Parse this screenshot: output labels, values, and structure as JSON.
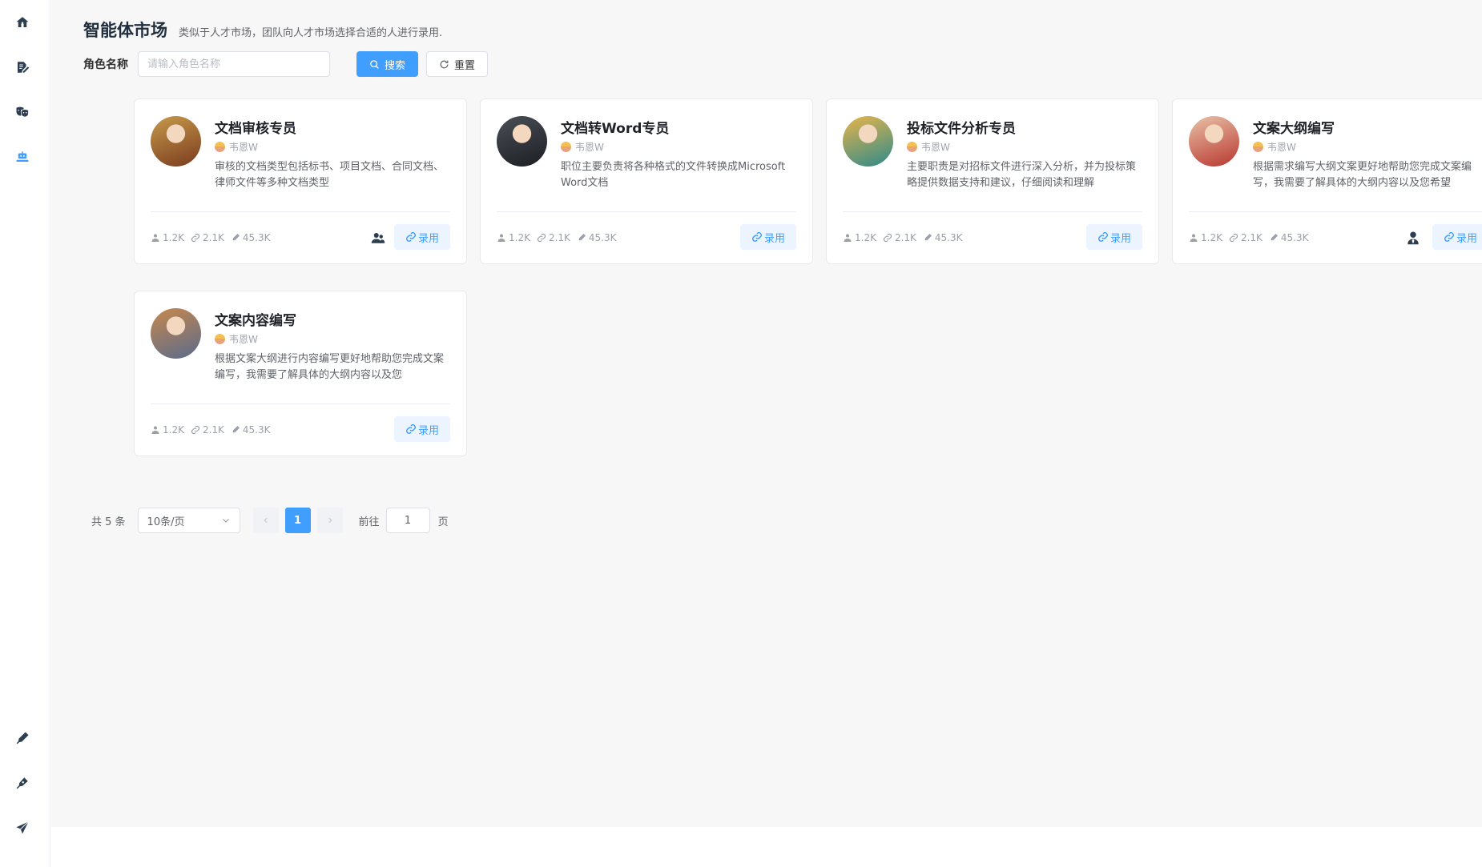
{
  "sidebar": {
    "items": [
      {
        "name": "home-icon",
        "active": false
      },
      {
        "name": "edit-doc-icon",
        "active": false
      },
      {
        "name": "theater-mask-icon",
        "active": false
      },
      {
        "name": "robot-market-icon",
        "active": true
      },
      {
        "name": "pen-icon",
        "active": false
      },
      {
        "name": "pen-nib-icon",
        "active": false
      },
      {
        "name": "paper-plane-icon",
        "active": false
      }
    ]
  },
  "header": {
    "title": "智能体市场",
    "subtitle": "类似于人才市场，团队向人才市场选择合适的人进行录用."
  },
  "search": {
    "label": "角色名称",
    "placeholder": "请输入角色名称",
    "value": "",
    "search_label": "搜索",
    "reset_label": "重置"
  },
  "cards": [
    {
      "name": "文档审核专员",
      "author": "韦恩W",
      "desc": "审核的文档类型包括标书、项目文档、合同文档、律师文件等多种文档类型",
      "users": "1.2K",
      "links": "2.1K",
      "edits": "45.3K",
      "hire_label": "录用",
      "hired_badge": "users-icon",
      "avatar_colors": [
        "#c79a4b",
        "#7a3b1e"
      ]
    },
    {
      "name": "文档转Word专员",
      "author": "韦恩W",
      "desc": "职位主要负责将各种格式的文件转换成Microsoft Word文档",
      "users": "1.2K",
      "links": "2.1K",
      "edits": "45.3K",
      "hire_label": "录用",
      "hired_badge": "",
      "avatar_colors": [
        "#4a4f57",
        "#1c1e22"
      ]
    },
    {
      "name": "投标文件分析专员",
      "author": "韦恩W",
      "desc": "主要职责是对招标文件进行深入分析，并为投标策略提供数据支持和建议，仔细阅读和理解",
      "users": "1.2K",
      "links": "2.1K",
      "edits": "45.3K",
      "hire_label": "录用",
      "hired_badge": "",
      "avatar_colors": [
        "#e8b54a",
        "#2d8a8a"
      ]
    },
    {
      "name": "文案大纲编写",
      "author": "韦恩W",
      "desc": "根据需求编写大纲文案更好地帮助您完成文案编写，我需要了解具体的大纲内容以及您希望",
      "users": "1.2K",
      "links": "2.1K",
      "edits": "45.3K",
      "hire_label": "录用",
      "hired_badge": "user-tie-icon",
      "avatar_colors": [
        "#e9c2a8",
        "#b8372f"
      ]
    },
    {
      "name": "文案内容编写",
      "author": "韦恩W",
      "desc": "根据文案大纲进行内容编写更好地帮助您完成文案编写，我需要了解具体的大纲内容以及您",
      "users": "1.2K",
      "links": "2.1K",
      "edits": "45.3K",
      "hire_label": "录用",
      "hired_badge": "",
      "avatar_colors": [
        "#c7884e",
        "#5a6b8c"
      ]
    }
  ],
  "pagination": {
    "total_text": "共 5 条",
    "page_size": "10条/页",
    "current_page": "1",
    "goto_label": "前往",
    "goto_value": "1",
    "page_suffix": "页"
  },
  "colors": {
    "accent": "#409eff",
    "sidebar_active": "#409eff",
    "icon_dark": "#2c3e50"
  }
}
